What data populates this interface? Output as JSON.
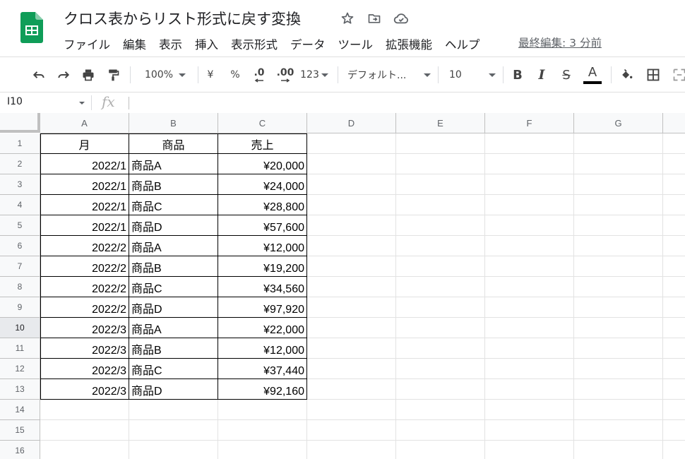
{
  "doc": {
    "title": "クロス表からリスト形式に戻す変換",
    "last_edit": "最終編集: 3 分前"
  },
  "menu": [
    "ファイル",
    "編集",
    "表示",
    "挿入",
    "表示形式",
    "データ",
    "ツール",
    "拡張機能",
    "ヘルプ"
  ],
  "toolbar": {
    "zoom": "100%",
    "currency": "¥",
    "percent": "%",
    "dec_less": ".0",
    "dec_more": ".00",
    "number_format": "123",
    "font": "デフォルト...",
    "font_size": "10",
    "bold": "B",
    "italic": "I",
    "strike": "S",
    "text_color_label": "A",
    "text_color": "#000000"
  },
  "formula_bar": {
    "name_box": "I10",
    "fx": "fx",
    "content": ""
  },
  "grid": {
    "columns": [
      "A",
      "B",
      "C",
      "D",
      "E",
      "F",
      "G"
    ],
    "rows": [
      "1",
      "2",
      "3",
      "4",
      "5",
      "6",
      "7",
      "8",
      "9",
      "10",
      "11",
      "12",
      "13",
      "14",
      "15",
      "16"
    ],
    "selected_row": "10",
    "headers": [
      "月",
      "商品",
      "売上"
    ],
    "data": [
      [
        "2022/1",
        "商品A",
        "¥20,000"
      ],
      [
        "2022/1",
        "商品B",
        "¥24,000"
      ],
      [
        "2022/1",
        "商品C",
        "¥28,800"
      ],
      [
        "2022/1",
        "商品D",
        "¥57,600"
      ],
      [
        "2022/2",
        "商品A",
        "¥12,000"
      ],
      [
        "2022/2",
        "商品B",
        "¥19,200"
      ],
      [
        "2022/2",
        "商品C",
        "¥34,560"
      ],
      [
        "2022/2",
        "商品D",
        "¥97,920"
      ],
      [
        "2022/3",
        "商品A",
        "¥22,000"
      ],
      [
        "2022/3",
        "商品B",
        "¥12,000"
      ],
      [
        "2022/3",
        "商品C",
        "¥37,440"
      ],
      [
        "2022/3",
        "商品D",
        "¥92,160"
      ]
    ]
  },
  "icons": {
    "logo": "sheets-logo-icon",
    "star": "star-icon",
    "move": "move-folder-icon",
    "cloud": "cloud-status-icon",
    "undo": "undo-icon",
    "redo": "redo-icon",
    "print": "print-icon",
    "paint_format": "paint-format-icon",
    "fill": "fill-color-icon",
    "borders": "borders-icon",
    "merge": "merge-cells-icon"
  },
  "colors": {
    "sheets_green": "#0f9d58",
    "header_bg": "#f8f9fa"
  }
}
